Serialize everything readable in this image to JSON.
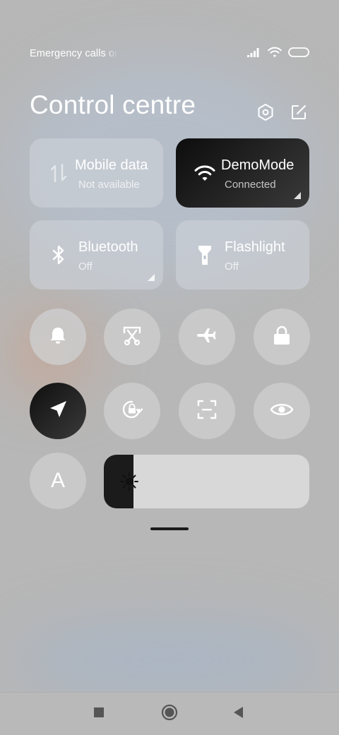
{
  "status_bar": {
    "left_text": "Emergency calls only"
  },
  "header": {
    "title": "Control centre"
  },
  "tiles": [
    {
      "id": "mobile-data",
      "name": "Mobile data",
      "status": "Not available",
      "active": false
    },
    {
      "id": "wifi",
      "name": "DemoMode",
      "status": "Connected",
      "active": true
    },
    {
      "id": "bluetooth",
      "name": "Bluetooth",
      "status": "Off",
      "active": false
    },
    {
      "id": "flashlight",
      "name": "Flashlight",
      "status": "Off",
      "active": false
    }
  ],
  "toggles": [
    {
      "id": "ring",
      "icon": "bell-icon",
      "active": false
    },
    {
      "id": "screenshot",
      "icon": "scissors-icon",
      "active": false
    },
    {
      "id": "airplane",
      "icon": "airplane-icon",
      "active": false
    },
    {
      "id": "lock",
      "icon": "lock-icon",
      "active": false
    },
    {
      "id": "location",
      "icon": "location-arrow-icon",
      "active": true
    },
    {
      "id": "rotation",
      "icon": "rotation-lock-icon",
      "active": false
    },
    {
      "id": "scanner",
      "icon": "scan-icon",
      "active": false
    },
    {
      "id": "reading-mode",
      "icon": "eye-icon",
      "active": false
    },
    {
      "id": "auto-brightness",
      "icon": "letter-a-icon",
      "active": false
    }
  ],
  "auto_brightness": {
    "label": "A"
  },
  "brightness": {
    "level": 0.145,
    "icon": "sun-icon"
  },
  "colors": {
    "background": "#b7b7b7",
    "active_tile": "#1a1a1a",
    "text": "#ffffff"
  }
}
